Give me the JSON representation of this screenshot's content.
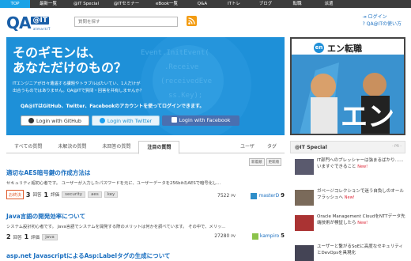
{
  "topnav": {
    "items": [
      "TOP",
      "最新一覧",
      "@IT Special",
      "@ITセミナー",
      "eBook一覧",
      "Q&A",
      "ITトレ",
      "ブログ",
      "転職",
      "派遣"
    ]
  },
  "header": {
    "logo_main": "QA",
    "logo_it": "@IT",
    "logo_sub": "atmarkIT",
    "search_placeholder": "質問を探す",
    "login_link": "ログイン",
    "howto_link": "QA@ITの使い方"
  },
  "hero": {
    "title_line1": "そのギモンは、",
    "title_line2": "あなただけのもの？",
    "desc_line1": "ITエンジニアが日々遭遇する課題やトラブルはたいてい、1人だけが",
    "desc_line2": "出合うものではありません。QA@ITで質問・回答を共有しませんか？",
    "login_prompt": "QA@ITはGitHub、Twitter、Facebookのアカウントを使ってログインできます。",
    "github_label": "Login with GitHub",
    "twitter_label": "Login with Twitter",
    "facebook_label": "Login with Facebook"
  },
  "ad": {
    "logo": "en",
    "title": "エン転職"
  },
  "tabs": {
    "items": [
      "すべての質問",
      "未解決の質問",
      "未回答の質問",
      "注目の質問"
    ],
    "users": "ユーザ",
    "tags": "タグ"
  },
  "sort": {
    "new_label": "新着順",
    "updated_label": "更新順"
  },
  "questions": [
    {
      "title": "適切なAES暗号鍵の作成方法は",
      "excerpt": "セキュリティ超初心者です。 ユーザーが入力したパスワードを元に、ユーザーデータを256bitのAESで暗号化し...",
      "status": "お終決",
      "answers": "3",
      "answers_label": "回答",
      "rating": "1",
      "rating_label": "評価",
      "tags": [
        "security",
        "aes",
        "key"
      ],
      "views": "7522",
      "views_unit": "PV",
      "user": "masterD",
      "user_score": "9"
    },
    {
      "title": "Java言語の開発効率について",
      "excerpt": "システム設計初心者です。 Java言語でシステムを開発する際のメリットは何かを調べています。 その中で、メリッ...",
      "status": "",
      "answers": "2",
      "answers_label": "回答",
      "rating": "1",
      "rating_label": "評価",
      "tags": [
        "java"
      ],
      "views": "27280",
      "views_unit": "PV",
      "user": "kampiro",
      "user_score": "5"
    },
    {
      "title": "asp.net JavascriptによるAsp:Labelタグの生成について",
      "excerpt": "",
      "status": "",
      "answers": "",
      "answers_label": "",
      "rating": "",
      "rating_label": "",
      "tags": [],
      "views": "",
      "views_unit": "",
      "user": "",
      "user_score": ""
    }
  ],
  "special": {
    "title": "@IT Special",
    "pr": "- PR -",
    "items": [
      {
        "text": "IT部門へのプレッシャーは強まるばかり……いますぐできること",
        "new": "New!"
      },
      {
        "text": "ガベージコレクションで迷う自負しのオールフラッシュへ",
        "new": "New!"
      },
      {
        "text": "Oracle Management CloudをNTTデータ先端技術が検証したら",
        "new": "New!"
      },
      {
        "text": "ユーザーと繋がるSoEに高度なセキュリティとDevOpsを具現化",
        "new": ""
      }
    ]
  },
  "colors": {
    "accent": "#1aa2e6",
    "hero_bg": "#1e90d8",
    "link": "#1a6fc0",
    "nav_bg": "#3c3c3c"
  }
}
